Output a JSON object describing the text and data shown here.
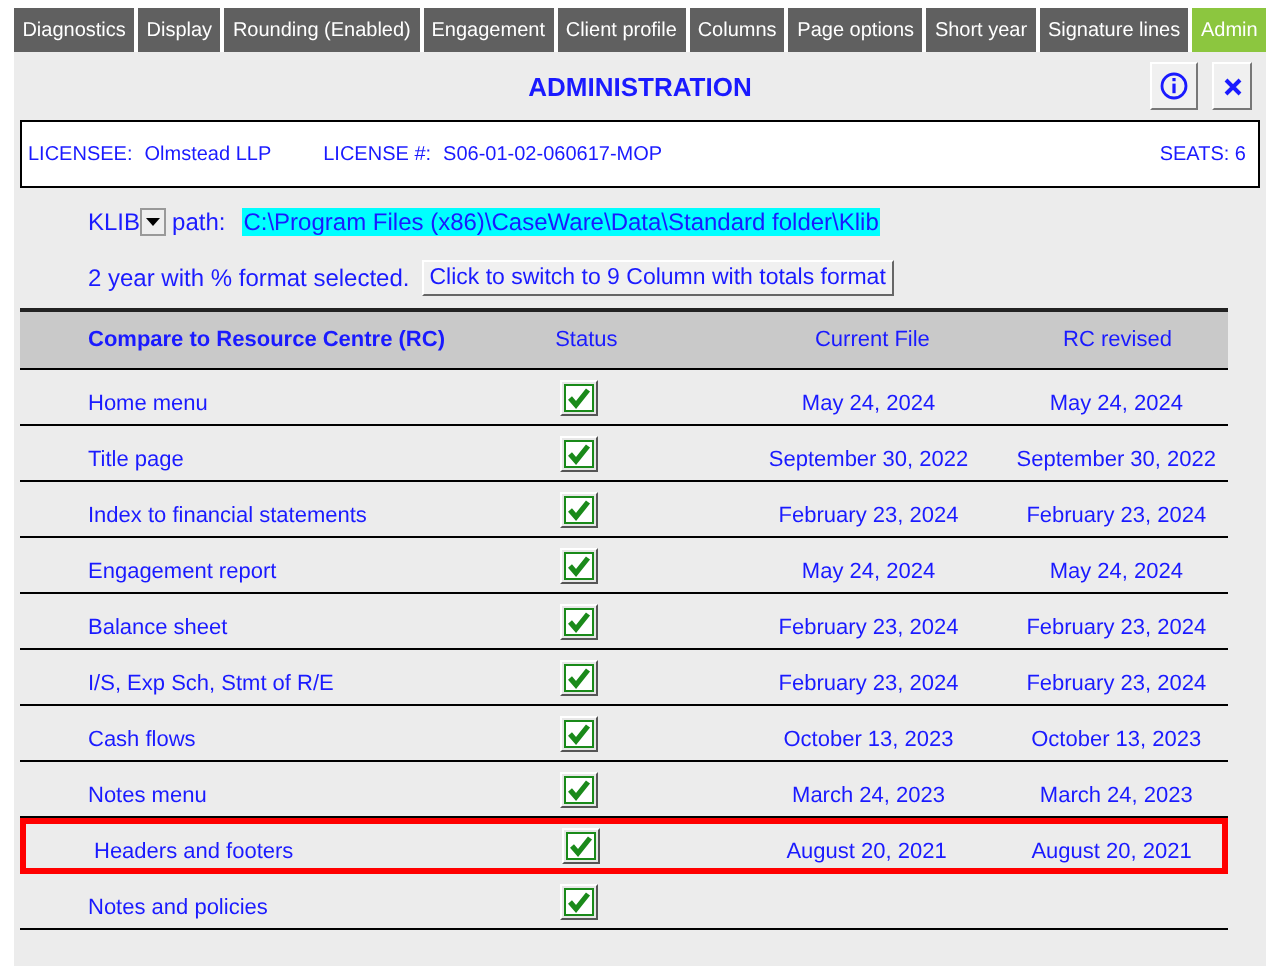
{
  "tabs": [
    {
      "label": "Diagnostics",
      "selected": false
    },
    {
      "label": "Display",
      "selected": false
    },
    {
      "label": "Rounding (Enabled)",
      "selected": false
    },
    {
      "label": "Engagement",
      "selected": false
    },
    {
      "label": "Client profile",
      "selected": false
    },
    {
      "label": "Columns",
      "selected": false
    },
    {
      "label": "Page options",
      "selected": false
    },
    {
      "label": "Short year",
      "selected": false
    },
    {
      "label": "Signature lines",
      "selected": false
    },
    {
      "label": "Admin",
      "selected": true
    }
  ],
  "title": "ADMINISTRATION",
  "license": {
    "licensee_label": "LICENSEE:",
    "licensee": "Olmstead LLP",
    "license_label": "LICENSE #:",
    "license_number": "S06-01-02-060617-MOP",
    "seats": "SEATS: 6"
  },
  "klib": {
    "dropdown": "KLIB",
    "path_label": "path:",
    "path": "C:\\Program Files (x86)\\CaseWare\\Data\\Standard folder\\Klib"
  },
  "format": {
    "text": "2 year with % format selected.",
    "button": "Click to switch to 9 Column with totals format"
  },
  "table": {
    "columns": [
      "Compare to Resource Centre (RC)",
      "Status",
      "Current File",
      "RC revised"
    ],
    "rows": [
      {
        "name": "Home menu",
        "checked": true,
        "current": "May 24, 2024",
        "rc": "May 24, 2024",
        "highlighted": false
      },
      {
        "name": "Title page",
        "checked": true,
        "current": "September 30, 2022",
        "rc": "September 30, 2022",
        "highlighted": false
      },
      {
        "name": "Index to financial statements",
        "checked": true,
        "current": "February 23, 2024",
        "rc": "February 23, 2024",
        "highlighted": false
      },
      {
        "name": "Engagement report",
        "checked": true,
        "current": "May 24, 2024",
        "rc": "May 24, 2024",
        "highlighted": false
      },
      {
        "name": "Balance sheet",
        "checked": true,
        "current": "February 23, 2024",
        "rc": "February 23, 2024",
        "highlighted": false
      },
      {
        "name": "I/S, Exp Sch, Stmt of R/E",
        "checked": true,
        "current": "February 23, 2024",
        "rc": "February 23, 2024",
        "highlighted": false
      },
      {
        "name": "Cash flows",
        "checked": true,
        "current": "October 13, 2023",
        "rc": "October 13, 2023",
        "highlighted": false
      },
      {
        "name": "Notes menu",
        "checked": true,
        "current": "March 24, 2023",
        "rc": "March 24, 2023",
        "highlighted": false
      },
      {
        "name": "Headers and footers",
        "checked": true,
        "current": "August 20, 2021",
        "rc": "August 20, 2021",
        "highlighted": true
      },
      {
        "name": "Notes and policies",
        "checked": true,
        "highlighted": false
      }
    ]
  }
}
